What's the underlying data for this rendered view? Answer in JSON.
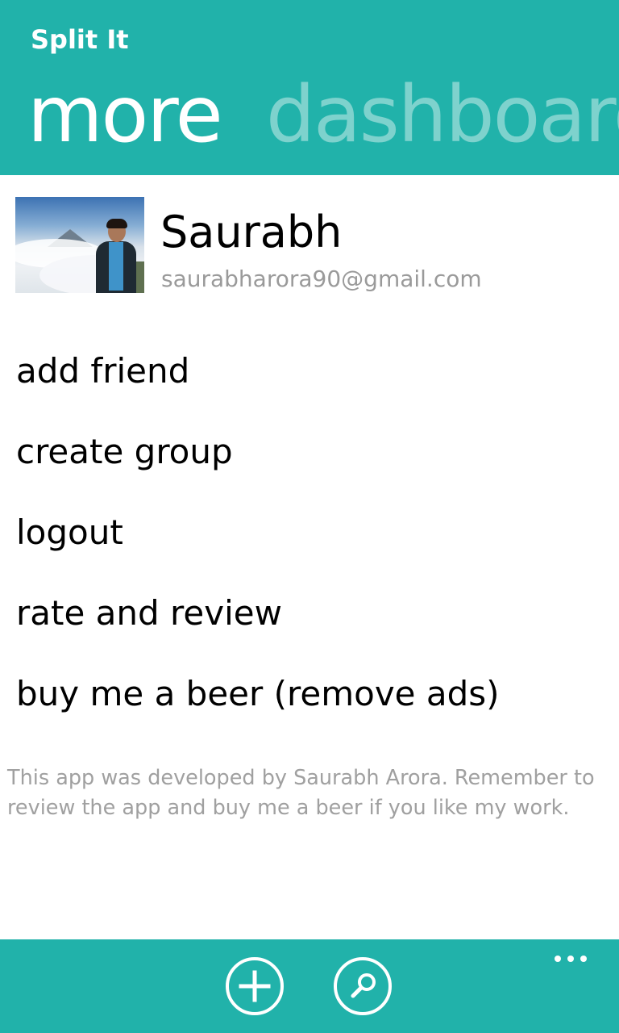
{
  "theme": {
    "accent": "#21b2aa",
    "text_primary": "#000000",
    "text_secondary": "#9a9a9a"
  },
  "header": {
    "app_title": "Split It",
    "pivots": [
      {
        "label": "more",
        "active": true
      },
      {
        "label": "dashboard",
        "active": false
      }
    ]
  },
  "profile": {
    "name": "Saurabh",
    "email": "saurabharora90@gmail.com",
    "avatar_icon": "profile-photo"
  },
  "menu": {
    "items": [
      {
        "label": "add friend"
      },
      {
        "label": "create group"
      },
      {
        "label": "logout"
      },
      {
        "label": "rate and review"
      },
      {
        "label": "buy me a beer (remove ads)"
      }
    ]
  },
  "footer_note": "This app was developed by Saurabh Arora. Remember to review the app and buy me a beer if you like my work.",
  "appbar": {
    "buttons": [
      {
        "icon": "add-icon"
      },
      {
        "icon": "search-icon"
      }
    ],
    "more_icon": "ellipsis-icon"
  }
}
